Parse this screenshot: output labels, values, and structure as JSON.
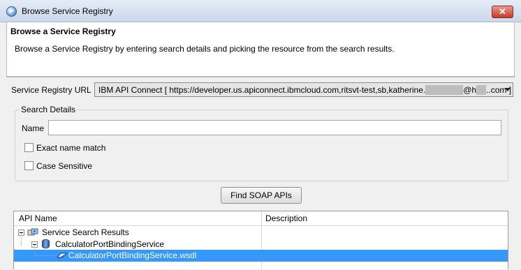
{
  "window": {
    "title": "Browse Service Registry",
    "close_label": "✕",
    "icon": "app-globe-icon"
  },
  "header": {
    "title": "Browse a Service Registry",
    "description": "Browse a Service Registry by entering search details and picking the resource from the search results."
  },
  "registry": {
    "label": "Service Registry URL",
    "value_prefix": "IBM API Connect [ https://developer.us.apiconnect.ibmcloud.com,ritsvt-test,sb,katherine.",
    "value_at": "@h",
    "value_suffix": "..com ]"
  },
  "search": {
    "group_label": "Search Details",
    "name_label": "Name",
    "name_value": "",
    "exact_match_label": "Exact name match",
    "exact_match_checked": false,
    "case_sensitive_label": "Case Sensitive",
    "case_sensitive_checked": false,
    "find_button_label": "Find SOAP APIs"
  },
  "results": {
    "columns": [
      "API Name",
      "Description"
    ],
    "rows": [
      {
        "label": "Service Search Results",
        "icon": "registry-icon",
        "level": 0,
        "expanded": true,
        "selected": false
      },
      {
        "label": "CalculatorPortBindingService",
        "icon": "database-icon",
        "level": 1,
        "expanded": true,
        "selected": false
      },
      {
        "label": "CalculatorPortBindingService.wsdl",
        "icon": "wsdl-file-icon",
        "level": 2,
        "expanded": false,
        "selected": true
      }
    ]
  },
  "colors": {
    "selection": "#3399ff",
    "close_button": "#c43a28"
  }
}
